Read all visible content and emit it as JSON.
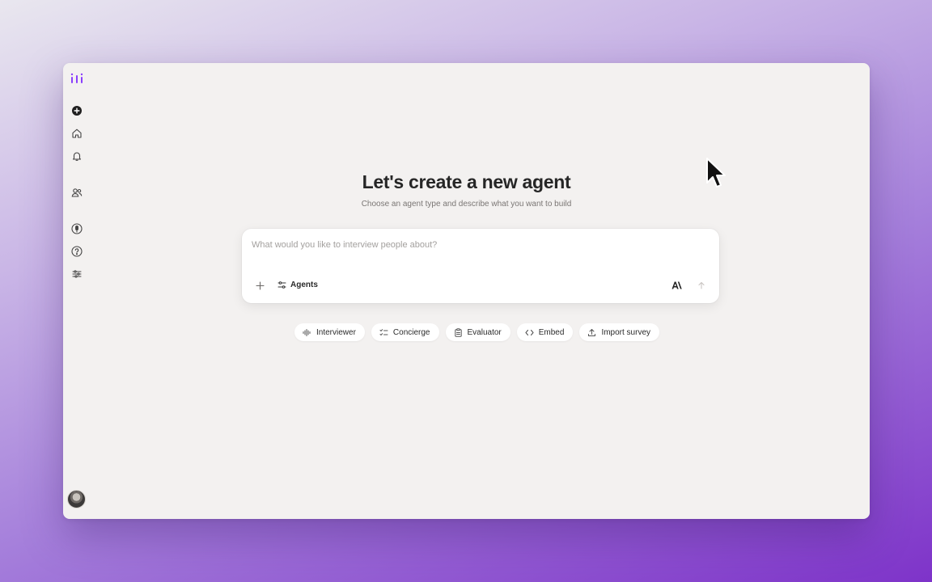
{
  "main": {
    "title": "Let's create a new agent",
    "subtitle": "Choose an agent type and describe what you want to build"
  },
  "composer": {
    "placeholder": "What would you like to interview people about?",
    "value": "",
    "agents_label": "Agents"
  },
  "chips": [
    {
      "label": "Interviewer",
      "icon": "waveform-icon"
    },
    {
      "label": "Concierge",
      "icon": "checklist-icon"
    },
    {
      "label": "Evaluator",
      "icon": "clipboard-icon"
    },
    {
      "label": "Embed",
      "icon": "code-icon"
    },
    {
      "label": "Import survey",
      "icon": "upload-icon"
    }
  ],
  "sidebar": {
    "items": [
      {
        "icon": "new-plus-icon"
      },
      {
        "icon": "home-icon"
      },
      {
        "icon": "bell-icon"
      },
      {
        "icon": "users-icon"
      },
      {
        "icon": "microphone-icon"
      },
      {
        "icon": "help-icon"
      },
      {
        "icon": "sliders-icon"
      }
    ]
  },
  "colors": {
    "accent": "#8a3ffc",
    "window_bg": "#f3f1f0",
    "card_bg": "#ffffff"
  }
}
